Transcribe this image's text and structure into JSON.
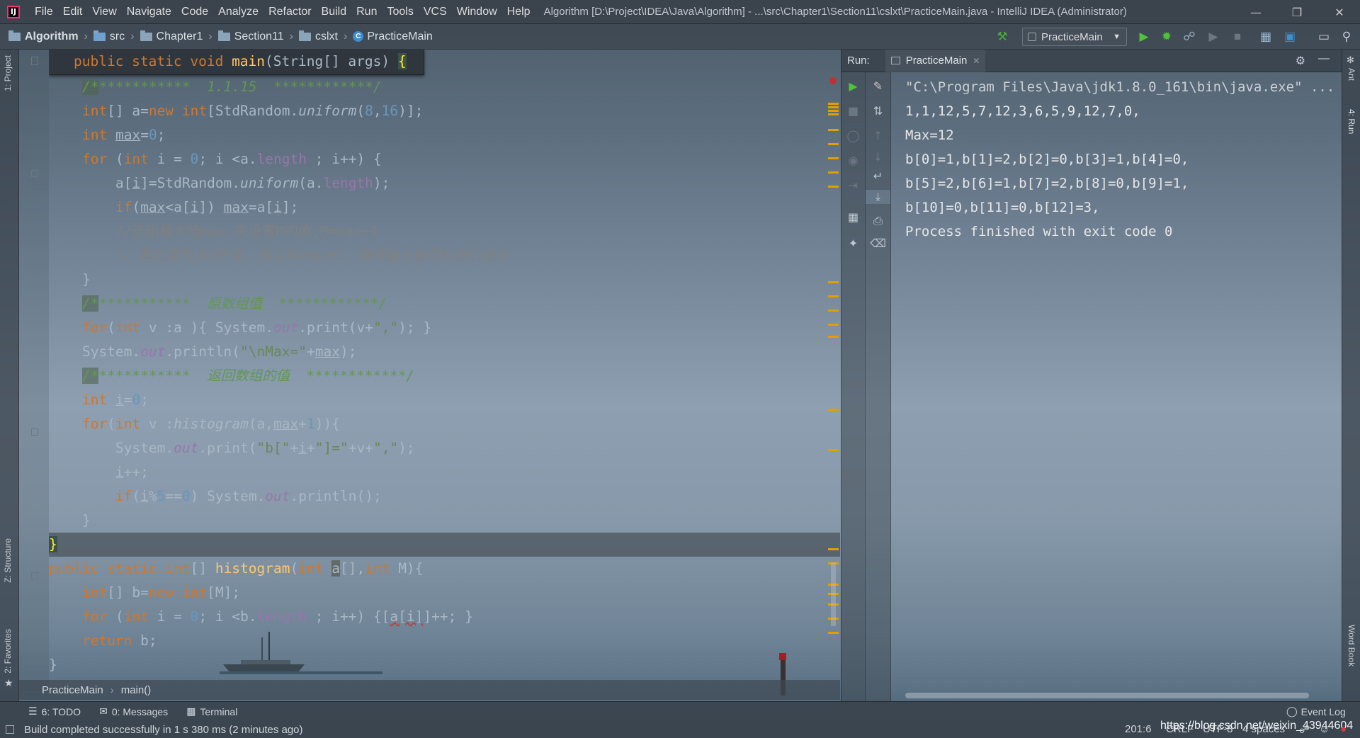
{
  "title_bar": {
    "menu": [
      "File",
      "Edit",
      "View",
      "Navigate",
      "Code",
      "Analyze",
      "Refactor",
      "Build",
      "Run",
      "Tools",
      "VCS",
      "Window",
      "Help"
    ],
    "window_title": "Algorithm [D:\\Project\\IDEA\\Java\\Algorithm] - ...\\src\\Chapter1\\Section11\\cslxt\\PracticeMain.java - IntelliJ IDEA (Administrator)"
  },
  "breadcrumbs": [
    "Algorithm",
    "src",
    "Chapter1",
    "Section11",
    "cslxt",
    "PracticeMain"
  ],
  "run_config": "PracticeMain",
  "left_tabs": {
    "project": "1: Project",
    "structure": "Z: Structure",
    "favorites": "2: Favorites"
  },
  "right_tabs": {
    "ant": "Ant",
    "run": "4: Run",
    "wordbook": "Word Book"
  },
  "editor": {
    "sticky_header": "public static void main(String[] args) {",
    "crumb_class": "PracticeMain",
    "crumb_method": "main()",
    "lines": [
      "/************  1.1.15  ************/",
      "int[] a=new int[StdRandom.uniform(8,16)];",
      "int max=0;",
      "for (int i = 0; i <a.length ; i++) {",
      "a[i]=StdRandom.uniform(a.length);",
      "if(max<a[i]) max=a[i];",
      "//选出最大值max,来设置M的值,M=max+1",
      "// 数组索引从0开始，所以M=max+1，确保最大值可以进行统计",
      "}",
      "/************  原数组值  ************/",
      "for(int v :a ){ System.out.print(v+\",\"); }",
      "System.out.println(\"\\nMax=\"+max);",
      "/************  返回数组的值  ************/",
      "int i=0;",
      "for(int v :histogram(a,max+1)){",
      "System.out.print(\"b[\"+i+\"]=\"+v+\",\");",
      "i++;",
      "if(i%5==0) System.out.println();",
      "}",
      "}",
      "public static int[] histogram(int a[],int M){",
      "int[] b=new int[M];",
      "for (int i = 0; i <b.length ; i++) {[a[i]]++; }",
      "return b;",
      "}"
    ]
  },
  "run_panel": {
    "label": "Run:",
    "tab": "PracticeMain",
    "output": [
      "\"C:\\Program Files\\Java\\jdk1.8.0_161\\bin\\java.exe\" ...",
      "1,1,12,5,7,12,3,6,5,9,12,7,0,",
      "Max=12",
      "b[0]=1,b[1]=2,b[2]=0,b[3]=1,b[4]=0,",
      "b[5]=2,b[6]=1,b[7]=2,b[8]=0,b[9]=1,",
      "b[10]=0,b[11]=0,b[12]=3,",
      "Process finished with exit code 0"
    ]
  },
  "tool_windows": {
    "todo": "6: TODO",
    "messages": "0: Messages",
    "terminal": "Terminal",
    "event_log": "Event Log"
  },
  "status": {
    "message": "Build completed successfully in 1 s 380 ms (2 minutes ago)",
    "position": "201:6",
    "line_sep": "CRLF",
    "encoding": "UTF-8",
    "indent": "4 spaces",
    "watermark": "https://blog.csdn.net/weixin_43944604"
  },
  "colors": {
    "keyword": "#cc7832",
    "method": "#ffc66d",
    "number": "#6897bb",
    "string": "#6a8759",
    "comment": "#808080",
    "doc": "#629755",
    "field": "#9876aa",
    "plain": "#a9b7c6"
  }
}
